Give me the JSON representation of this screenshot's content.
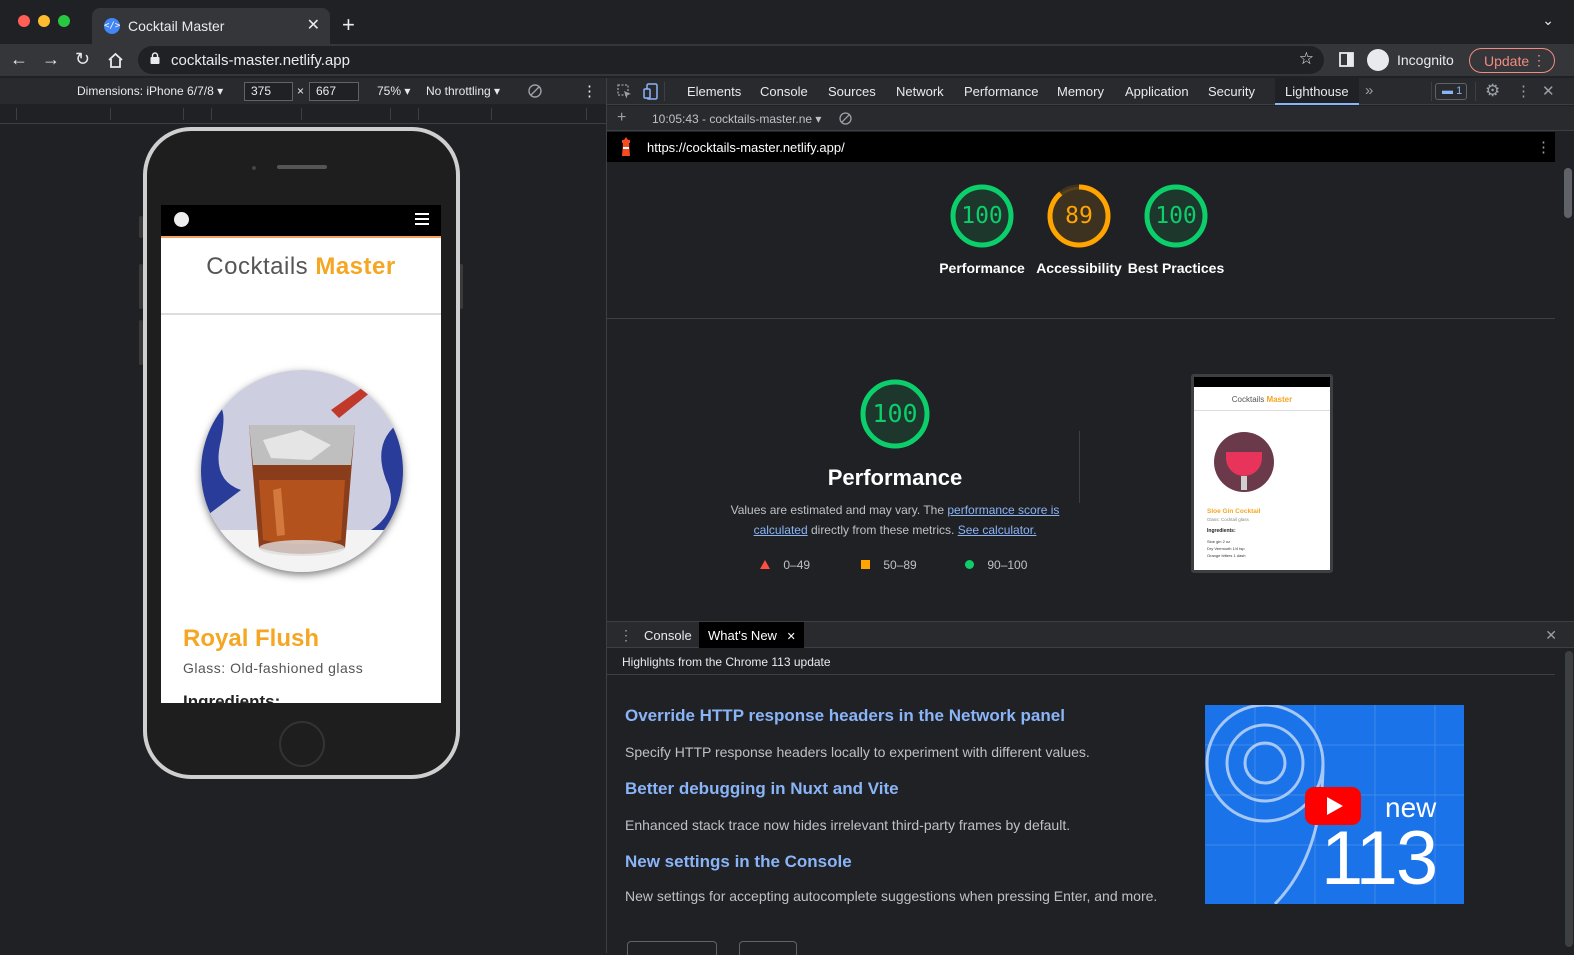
{
  "browser": {
    "tab_title": "Cocktail Master",
    "url": "cocktails-master.netlify.app",
    "incognito_label": "Incognito",
    "update_label": "Update"
  },
  "device_toolbar": {
    "dimensions_label": "Dimensions: iPhone 6/7/8",
    "width": "375",
    "height": "667",
    "times": "×",
    "zoom": "75%",
    "throttling": "No throttling"
  },
  "page": {
    "brand_plain": "Cocktails",
    "brand_accent": "Master",
    "drink_name": "Royal Flush",
    "glass": "Glass: Old-fashioned glass",
    "ingredients_heading": "Ingredients:"
  },
  "devtools": {
    "tabs": [
      "Elements",
      "Console",
      "Sources",
      "Network",
      "Performance",
      "Memory",
      "Application",
      "Security",
      "Lighthouse"
    ],
    "more_tabs": "»",
    "issues_count": "1"
  },
  "lighthouse": {
    "report_selector": "10:05:43 - cocktails-master.ne",
    "report_url": "https://cocktails-master.netlify.app/",
    "scores": [
      {
        "value": 100,
        "label": "Performance",
        "color": "#0cce6b"
      },
      {
        "value": 89,
        "label": "Accessibility",
        "color": "#ffa400"
      },
      {
        "value": 100,
        "label": "Best Practices",
        "color": "#0cce6b"
      }
    ],
    "detail": {
      "score": 100,
      "title": "Performance",
      "desc_1": "Values are estimated and may vary. The ",
      "link_1": "performance score is calculated",
      "desc_2": " directly from these metrics. ",
      "link_2": "See calculator.",
      "legend": [
        {
          "range": "0–49",
          "color": "#ff4e42"
        },
        {
          "range": "50–89",
          "color": "#ffa400"
        },
        {
          "range": "90–100",
          "color": "#0cce6b"
        }
      ]
    },
    "preview": {
      "brand_plain": "Cocktails",
      "brand_accent": "Master",
      "drink_name": "Sloe Gin Cocktail",
      "glass": "Glass: Cocktail glass",
      "ingredients": "Ingredients:",
      "lines": [
        "Sloe gin  2 oz",
        "Dry Vermouth  1/4 tsp",
        "Orange bitters  1 dash"
      ]
    }
  },
  "drawer": {
    "tabs": [
      "Console",
      "What's New"
    ],
    "subtitle": "Highlights from the Chrome 113 update",
    "items": [
      {
        "title": "Override HTTP response headers in the Network panel",
        "desc": "Specify HTTP response headers locally to experiment with different values."
      },
      {
        "title": "Better debugging in Nuxt and Vite",
        "desc": "Enhanced stack trace now hides irrelevant third-party frames by default."
      },
      {
        "title": "New settings in the Console",
        "desc": "New settings for accepting autocomplete suggestions when pressing Enter, and more."
      }
    ],
    "video": {
      "label_new": "new",
      "label_version": "113"
    }
  }
}
